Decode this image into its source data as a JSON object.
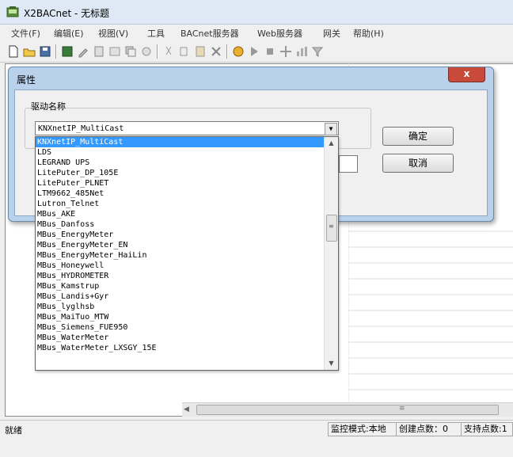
{
  "window": {
    "title": "X2BACnet - 无标题"
  },
  "menu": [
    "文件(F)",
    "编辑(E)",
    "视图(V)",
    "工具",
    "BACnet服务器",
    "Web服务器",
    "网关",
    "帮助(H)"
  ],
  "dialog": {
    "title": "属性",
    "close_label": "x",
    "group_label": "驱动名称",
    "combo_value": "KNXnetIP_MultiCast",
    "ok_label": "确定",
    "cancel_label": "取消"
  },
  "dropdown": {
    "options": [
      "KNXnetIP_MultiCast",
      "LDS",
      "LEGRAND UPS",
      "LitePuter_DP_105E",
      "LitePuter_PLNET",
      "LTM9662_485Net",
      "Lutron_Telnet",
      "MBus_AKE",
      "MBus_Danfoss",
      "MBus_EnergyMeter",
      "MBus_EnergyMeter_EN",
      "MBus_EnergyMeter_HaiLin",
      "MBus_Honeywell",
      "MBus_HYDROMETER",
      "MBus_Kamstrup",
      "MBus_Landis+Gyr",
      "MBus_lyglhsb",
      "MBus_MaiTuo_MTW",
      "MBus_Siemens_FUE950",
      "MBus_WaterMeter",
      "MBus_WaterMeter_LXSGY_15E"
    ],
    "selected_index": 0
  },
  "status": {
    "ready": "就绪",
    "mode": "监控模式:本地",
    "points": "创建点数：0",
    "supported": "支持点数:1"
  }
}
